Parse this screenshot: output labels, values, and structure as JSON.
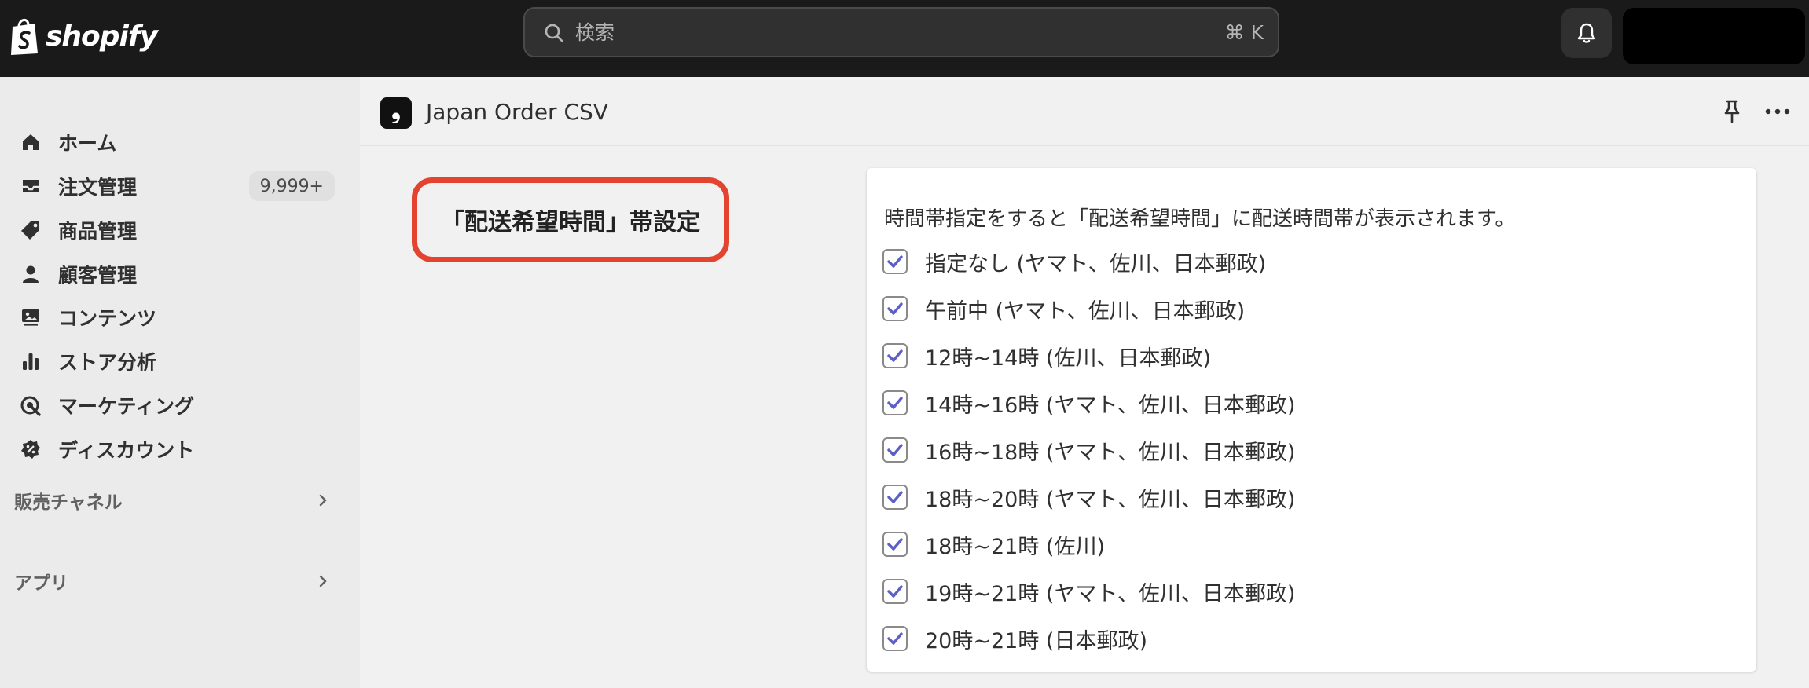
{
  "topbar": {
    "logo_text": "shopify",
    "search": {
      "placeholder": "検索",
      "shortcut": "⌘ K"
    }
  },
  "sidebar": {
    "items": [
      {
        "label": "ホーム",
        "icon": "home-icon"
      },
      {
        "label": "注文管理",
        "icon": "inbox-icon",
        "badge": "9,999+"
      },
      {
        "label": "商品管理",
        "icon": "tag-icon"
      },
      {
        "label": "顧客管理",
        "icon": "person-icon"
      },
      {
        "label": "コンテンツ",
        "icon": "image-content-icon"
      },
      {
        "label": "ストア分析",
        "icon": "bar-chart-icon"
      },
      {
        "label": "マーケティング",
        "icon": "target-icon"
      },
      {
        "label": "ディスカウント",
        "icon": "discount-icon"
      }
    ],
    "sections": [
      {
        "label": "販売チャネル"
      },
      {
        "label": "アプリ"
      }
    ]
  },
  "app_header": {
    "icon_glyph": "❟",
    "title": "Japan Order CSV"
  },
  "setting": {
    "title": "「配送希望時間」帯設定",
    "description": "時間帯指定をすると「配送希望時間」に配送時間帯が表示されます。",
    "options": [
      {
        "label": "指定なし (ヤマト、佐川、日本郵政)",
        "checked": true
      },
      {
        "label": "午前中 (ヤマト、佐川、日本郵政)",
        "checked": true
      },
      {
        "label": "12時~14時 (佐川、日本郵政)",
        "checked": true
      },
      {
        "label": "14時~16時 (ヤマト、佐川、日本郵政)",
        "checked": true
      },
      {
        "label": "16時~18時 (ヤマト、佐川、日本郵政)",
        "checked": true
      },
      {
        "label": "18時~20時 (ヤマト、佐川、日本郵政)",
        "checked": true
      },
      {
        "label": "18時~21時 (佐川)",
        "checked": true
      },
      {
        "label": "19時~21時 (ヤマト、佐川、日本郵政)",
        "checked": true
      },
      {
        "label": "20時~21時 (日本郵政)",
        "checked": true
      }
    ]
  },
  "colors": {
    "topbar": "#1a1a1a",
    "checkbox_accent": "#5b5fc7",
    "highlight_border": "#e3432f"
  }
}
